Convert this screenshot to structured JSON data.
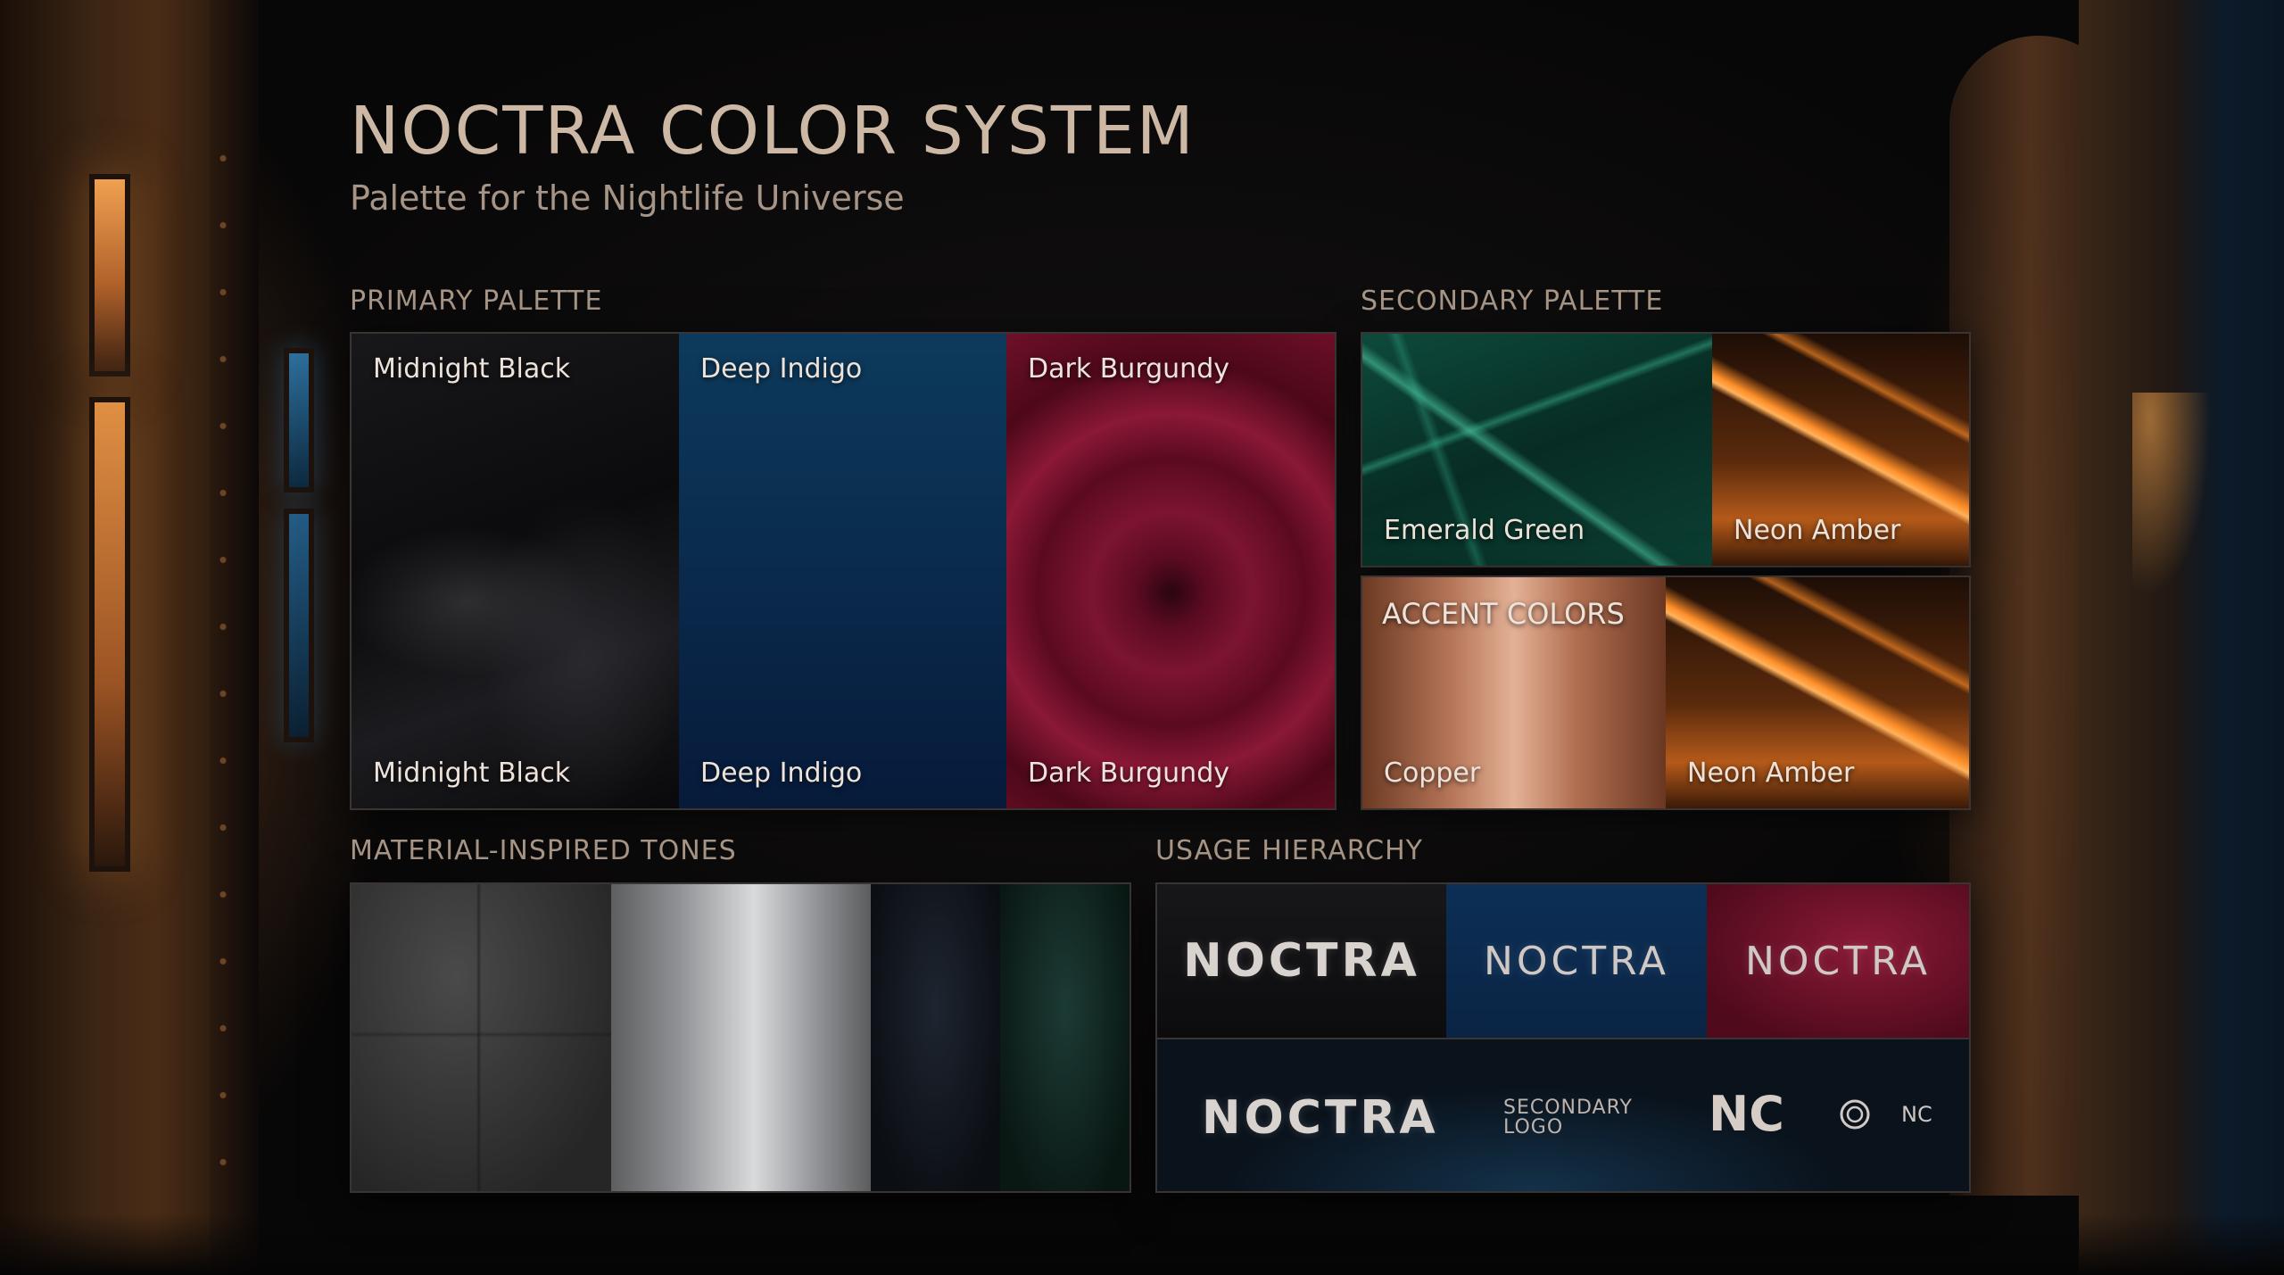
{
  "header": {
    "title": "NOCTRA COLOR SYSTEM",
    "subtitle": "Palette for the Nightlife Universe"
  },
  "primary": {
    "label": "PRIMARY PALETTE",
    "swatches": [
      {
        "top": "Midnight Black",
        "bottom": "Midnight Black",
        "color": "#0f0f12"
      },
      {
        "top": "Deep Indigo",
        "bottom": "Deep Indigo",
        "color": "#0a2c4e"
      },
      {
        "top": "Dark Burgundy",
        "bottom": "Dark Burgundy",
        "color": "#6d1029"
      }
    ]
  },
  "secondary": {
    "label": "SECONDARY PALETTE",
    "swatches": [
      {
        "label": "Emerald Green",
        "color": "#0e4a3c"
      },
      {
        "label": "Neon Amber",
        "color": "#ff8f2a"
      }
    ]
  },
  "accent": {
    "label": "ACCENT COLORS",
    "swatches": [
      {
        "label": "Copper",
        "color": "#b7775a"
      },
      {
        "label": "Neon Amber",
        "color": "#ff8f2a"
      }
    ]
  },
  "materials": {
    "label": "MATERIAL-INSPIRED TONES"
  },
  "usage": {
    "label": "USAGE HIERARCHY",
    "wordmark": "NOCTRA",
    "secondary_logo": "SECONDARY LOGO",
    "monogram": "NC",
    "mini_mark": "NC"
  }
}
